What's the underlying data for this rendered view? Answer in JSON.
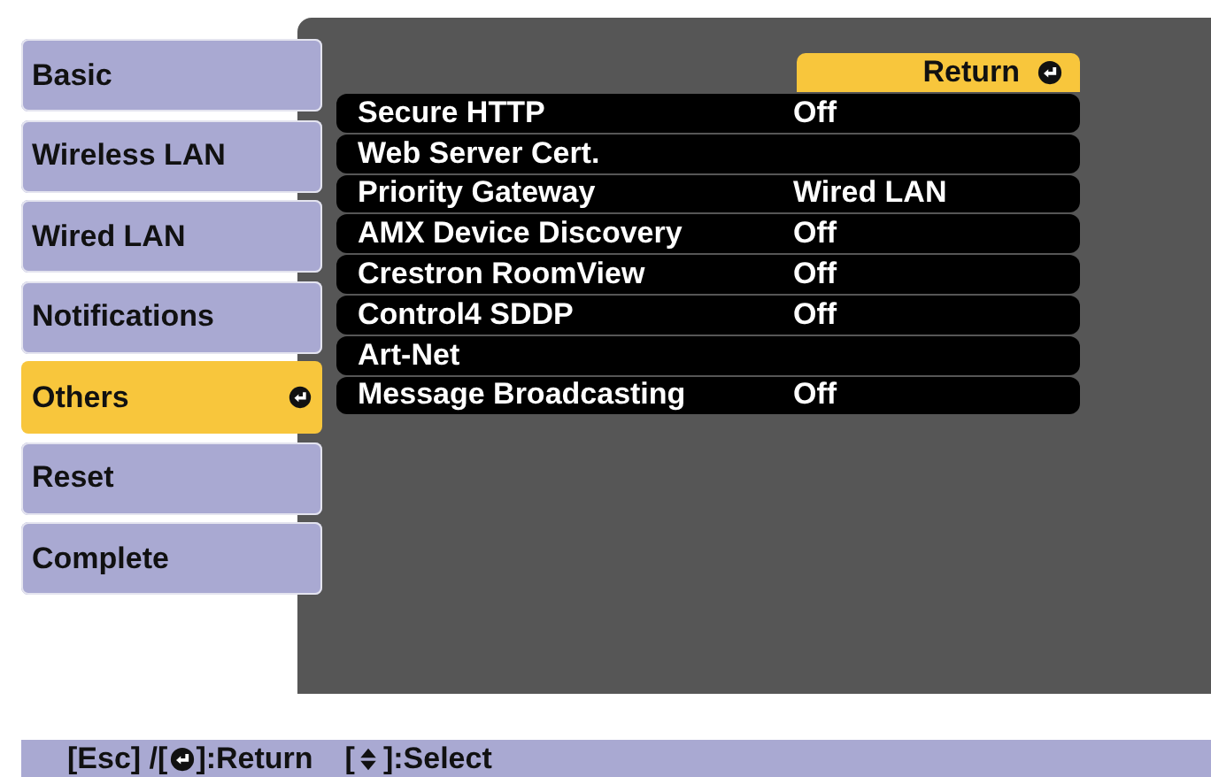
{
  "tabs": [
    {
      "label": "Basic",
      "selected": false
    },
    {
      "label": "Wireless LAN",
      "selected": false
    },
    {
      "label": "Wired LAN",
      "selected": false
    },
    {
      "label": "Notifications",
      "selected": false
    },
    {
      "label": "Others",
      "selected": true
    },
    {
      "label": "Reset",
      "selected": false
    },
    {
      "label": "Complete",
      "selected": false
    }
  ],
  "return_button": {
    "label": "Return"
  },
  "settings": [
    {
      "name": "Secure HTTP",
      "value": "Off"
    },
    {
      "name": "Web Server Cert."
    },
    {
      "name": "Priority Gateway",
      "value": "Wired LAN"
    },
    {
      "name": "AMX Device Discovery",
      "value": "Off"
    },
    {
      "name": "Crestron RoomView",
      "value": "Off"
    },
    {
      "name": "Control4 SDDP",
      "value": "Off"
    },
    {
      "name": "Art-Net"
    },
    {
      "name": "Message Broadcasting",
      "value": "Off"
    }
  ],
  "help_bar": [
    {
      "kind": "text",
      "text": "[Esc] /["
    },
    {
      "kind": "enter-icon"
    },
    {
      "kind": "text",
      "text": "]:Return"
    },
    {
      "kind": "text",
      "text": "["
    },
    {
      "kind": "updown-icon"
    },
    {
      "kind": "text",
      "text": "]:Select"
    }
  ]
}
